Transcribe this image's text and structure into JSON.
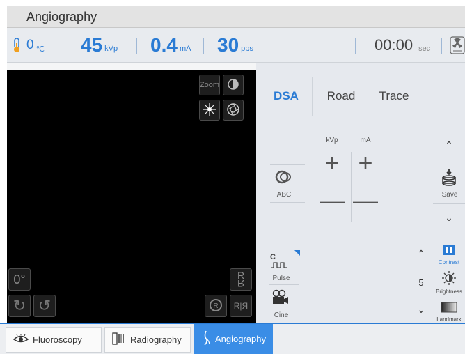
{
  "app": {
    "title": "Angiography"
  },
  "status": {
    "temp_value": "0",
    "temp_unit": "℃",
    "kvp_value": "45",
    "kvp_unit": "kVp",
    "ma_value": "0.4",
    "ma_unit": "mA",
    "pps_value": "30",
    "pps_unit": "pps",
    "time_value": "00:00",
    "time_unit": "sec"
  },
  "viewer": {
    "zoom_label": "Zoom",
    "rotation_label": "0°",
    "flip_label": "R",
    "mirror_label": "R|Я"
  },
  "modes": {
    "tabs": [
      "DSA",
      "Road",
      "Trace"
    ],
    "active": "DSA"
  },
  "exposure": {
    "kvp_label": "kVp",
    "ma_label": "mA",
    "abc_label": "ABC",
    "save_label": "Save"
  },
  "acquisition": {
    "pulse_letter": "C",
    "pulse_label": "Pulse",
    "cine_label": "Cine",
    "level_value": "5"
  },
  "image_adjust": {
    "contrast_label": "Contrast",
    "brightness_label": "Brightness",
    "landmark_label": "Landmark"
  },
  "bottom_tabs": [
    {
      "label": "Fluoroscopy",
      "icon": "eye-icon"
    },
    {
      "label": "Radiography",
      "icon": "film-icon"
    },
    {
      "label": "Angiography",
      "icon": "vessel-icon"
    }
  ],
  "colors": {
    "accent": "#2a7bd4",
    "active_tab": "#3a8de6",
    "viewer_bg": "#000000"
  }
}
